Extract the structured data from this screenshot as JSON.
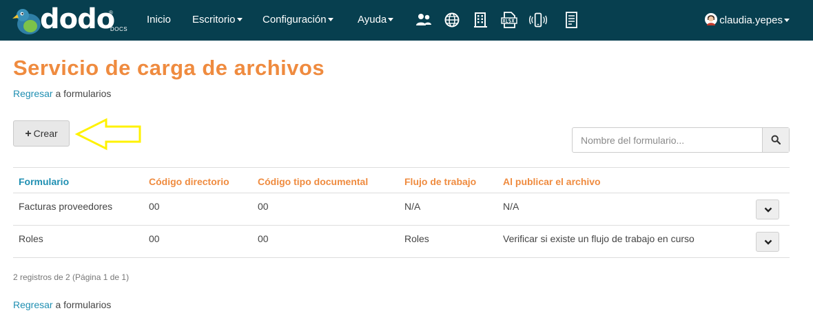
{
  "brand": {
    "name": "dodo",
    "sub": "DOCS",
    "reg": "®"
  },
  "nav": {
    "items": [
      {
        "label": "Inicio",
        "dropdown": false
      },
      {
        "label": "Escritorio",
        "dropdown": true
      },
      {
        "label": "Configuración",
        "dropdown": true
      },
      {
        "label": "Ayuda",
        "dropdown": true
      }
    ],
    "icons": [
      "users-icon",
      "globe-icon",
      "building-icon",
      "xlsx-file-icon",
      "mobile-vibrate-icon",
      "document-list-icon"
    ],
    "user": "claudia.yepes"
  },
  "page": {
    "title": "Servicio de carga de archivos",
    "back_link": "Regresar",
    "back_text": " a formularios"
  },
  "toolbar": {
    "create_label": "Crear",
    "search_placeholder": "Nombre del formulario..."
  },
  "table": {
    "headers": [
      "Formulario",
      "Código directorio",
      "Código tipo documental",
      "Flujo de trabajo",
      "Al publicar el archivo"
    ],
    "rows": [
      [
        "Facturas proveedores",
        "00",
        "00",
        "N/A",
        "N/A"
      ],
      [
        "Roles",
        "00",
        "00",
        "Roles",
        "Verificar si existe un flujo de trabajo en curso"
      ]
    ]
  },
  "footer": {
    "records": "2 registros de 2 (Página 1 de 1)"
  },
  "colors": {
    "navbar": "#073f4f",
    "accent_orange": "#ef8b3f",
    "link_blue": "#1f8fb2",
    "highlight_arrow": "#fff200"
  }
}
